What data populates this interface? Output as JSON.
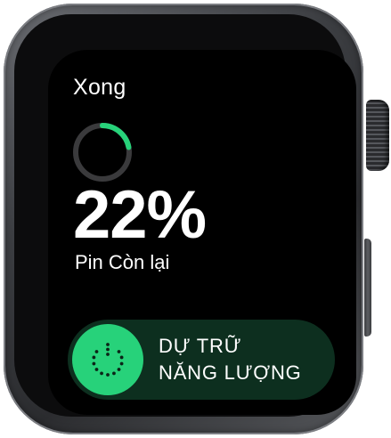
{
  "header": {
    "done_label": "Xong"
  },
  "battery": {
    "percent_label": "22%",
    "level": 0.22,
    "remaining_label": "Pin Còn lại",
    "ring_color": "#27d27a",
    "track_color": "#3a3a3c"
  },
  "power_reserve": {
    "line1": "DỰ TRỮ",
    "line2": "NĂNG LƯỢNG",
    "icon": "power-reserve-icon",
    "accent": "#27d27a",
    "background": "#0d2f1f"
  }
}
